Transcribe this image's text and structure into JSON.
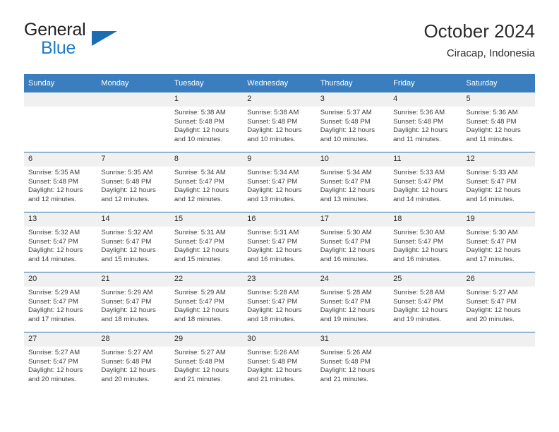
{
  "brand": {
    "name_top": "General",
    "name_bottom": "Blue",
    "triangle_color": "#1b6cb3",
    "blue_color": "#1f7ac4"
  },
  "header": {
    "title": "October 2024",
    "subtitle": "Ciracap, Indonesia"
  },
  "theme": {
    "header_bar": "#3a7ebf",
    "row_divider": "#2e6da4",
    "daynum_band": "#f0f0f0"
  },
  "weekday_headers": [
    "Sunday",
    "Monday",
    "Tuesday",
    "Wednesday",
    "Thursday",
    "Friday",
    "Saturday"
  ],
  "weeks": [
    [
      {
        "day": "",
        "lines": []
      },
      {
        "day": "",
        "lines": []
      },
      {
        "day": "1",
        "lines": [
          "Sunrise: 5:38 AM",
          "Sunset: 5:48 PM",
          "Daylight: 12 hours",
          "and 10 minutes."
        ]
      },
      {
        "day": "2",
        "lines": [
          "Sunrise: 5:38 AM",
          "Sunset: 5:48 PM",
          "Daylight: 12 hours",
          "and 10 minutes."
        ]
      },
      {
        "day": "3",
        "lines": [
          "Sunrise: 5:37 AM",
          "Sunset: 5:48 PM",
          "Daylight: 12 hours",
          "and 10 minutes."
        ]
      },
      {
        "day": "4",
        "lines": [
          "Sunrise: 5:36 AM",
          "Sunset: 5:48 PM",
          "Daylight: 12 hours",
          "and 11 minutes."
        ]
      },
      {
        "day": "5",
        "lines": [
          "Sunrise: 5:36 AM",
          "Sunset: 5:48 PM",
          "Daylight: 12 hours",
          "and 11 minutes."
        ]
      }
    ],
    [
      {
        "day": "6",
        "lines": [
          "Sunrise: 5:35 AM",
          "Sunset: 5:48 PM",
          "Daylight: 12 hours",
          "and 12 minutes."
        ]
      },
      {
        "day": "7",
        "lines": [
          "Sunrise: 5:35 AM",
          "Sunset: 5:48 PM",
          "Daylight: 12 hours",
          "and 12 minutes."
        ]
      },
      {
        "day": "8",
        "lines": [
          "Sunrise: 5:34 AM",
          "Sunset: 5:47 PM",
          "Daylight: 12 hours",
          "and 12 minutes."
        ]
      },
      {
        "day": "9",
        "lines": [
          "Sunrise: 5:34 AM",
          "Sunset: 5:47 PM",
          "Daylight: 12 hours",
          "and 13 minutes."
        ]
      },
      {
        "day": "10",
        "lines": [
          "Sunrise: 5:34 AM",
          "Sunset: 5:47 PM",
          "Daylight: 12 hours",
          "and 13 minutes."
        ]
      },
      {
        "day": "11",
        "lines": [
          "Sunrise: 5:33 AM",
          "Sunset: 5:47 PM",
          "Daylight: 12 hours",
          "and 14 minutes."
        ]
      },
      {
        "day": "12",
        "lines": [
          "Sunrise: 5:33 AM",
          "Sunset: 5:47 PM",
          "Daylight: 12 hours",
          "and 14 minutes."
        ]
      }
    ],
    [
      {
        "day": "13",
        "lines": [
          "Sunrise: 5:32 AM",
          "Sunset: 5:47 PM",
          "Daylight: 12 hours",
          "and 14 minutes."
        ]
      },
      {
        "day": "14",
        "lines": [
          "Sunrise: 5:32 AM",
          "Sunset: 5:47 PM",
          "Daylight: 12 hours",
          "and 15 minutes."
        ]
      },
      {
        "day": "15",
        "lines": [
          "Sunrise: 5:31 AM",
          "Sunset: 5:47 PM",
          "Daylight: 12 hours",
          "and 15 minutes."
        ]
      },
      {
        "day": "16",
        "lines": [
          "Sunrise: 5:31 AM",
          "Sunset: 5:47 PM",
          "Daylight: 12 hours",
          "and 16 minutes."
        ]
      },
      {
        "day": "17",
        "lines": [
          "Sunrise: 5:30 AM",
          "Sunset: 5:47 PM",
          "Daylight: 12 hours",
          "and 16 minutes."
        ]
      },
      {
        "day": "18",
        "lines": [
          "Sunrise: 5:30 AM",
          "Sunset: 5:47 PM",
          "Daylight: 12 hours",
          "and 16 minutes."
        ]
      },
      {
        "day": "19",
        "lines": [
          "Sunrise: 5:30 AM",
          "Sunset: 5:47 PM",
          "Daylight: 12 hours",
          "and 17 minutes."
        ]
      }
    ],
    [
      {
        "day": "20",
        "lines": [
          "Sunrise: 5:29 AM",
          "Sunset: 5:47 PM",
          "Daylight: 12 hours",
          "and 17 minutes."
        ]
      },
      {
        "day": "21",
        "lines": [
          "Sunrise: 5:29 AM",
          "Sunset: 5:47 PM",
          "Daylight: 12 hours",
          "and 18 minutes."
        ]
      },
      {
        "day": "22",
        "lines": [
          "Sunrise: 5:29 AM",
          "Sunset: 5:47 PM",
          "Daylight: 12 hours",
          "and 18 minutes."
        ]
      },
      {
        "day": "23",
        "lines": [
          "Sunrise: 5:28 AM",
          "Sunset: 5:47 PM",
          "Daylight: 12 hours",
          "and 18 minutes."
        ]
      },
      {
        "day": "24",
        "lines": [
          "Sunrise: 5:28 AM",
          "Sunset: 5:47 PM",
          "Daylight: 12 hours",
          "and 19 minutes."
        ]
      },
      {
        "day": "25",
        "lines": [
          "Sunrise: 5:28 AM",
          "Sunset: 5:47 PM",
          "Daylight: 12 hours",
          "and 19 minutes."
        ]
      },
      {
        "day": "26",
        "lines": [
          "Sunrise: 5:27 AM",
          "Sunset: 5:47 PM",
          "Daylight: 12 hours",
          "and 20 minutes."
        ]
      }
    ],
    [
      {
        "day": "27",
        "lines": [
          "Sunrise: 5:27 AM",
          "Sunset: 5:47 PM",
          "Daylight: 12 hours",
          "and 20 minutes."
        ]
      },
      {
        "day": "28",
        "lines": [
          "Sunrise: 5:27 AM",
          "Sunset: 5:48 PM",
          "Daylight: 12 hours",
          "and 20 minutes."
        ]
      },
      {
        "day": "29",
        "lines": [
          "Sunrise: 5:27 AM",
          "Sunset: 5:48 PM",
          "Daylight: 12 hours",
          "and 21 minutes."
        ]
      },
      {
        "day": "30",
        "lines": [
          "Sunrise: 5:26 AM",
          "Sunset: 5:48 PM",
          "Daylight: 12 hours",
          "and 21 minutes."
        ]
      },
      {
        "day": "31",
        "lines": [
          "Sunrise: 5:26 AM",
          "Sunset: 5:48 PM",
          "Daylight: 12 hours",
          "and 21 minutes."
        ]
      },
      {
        "day": "",
        "lines": []
      },
      {
        "day": "",
        "lines": []
      }
    ]
  ]
}
